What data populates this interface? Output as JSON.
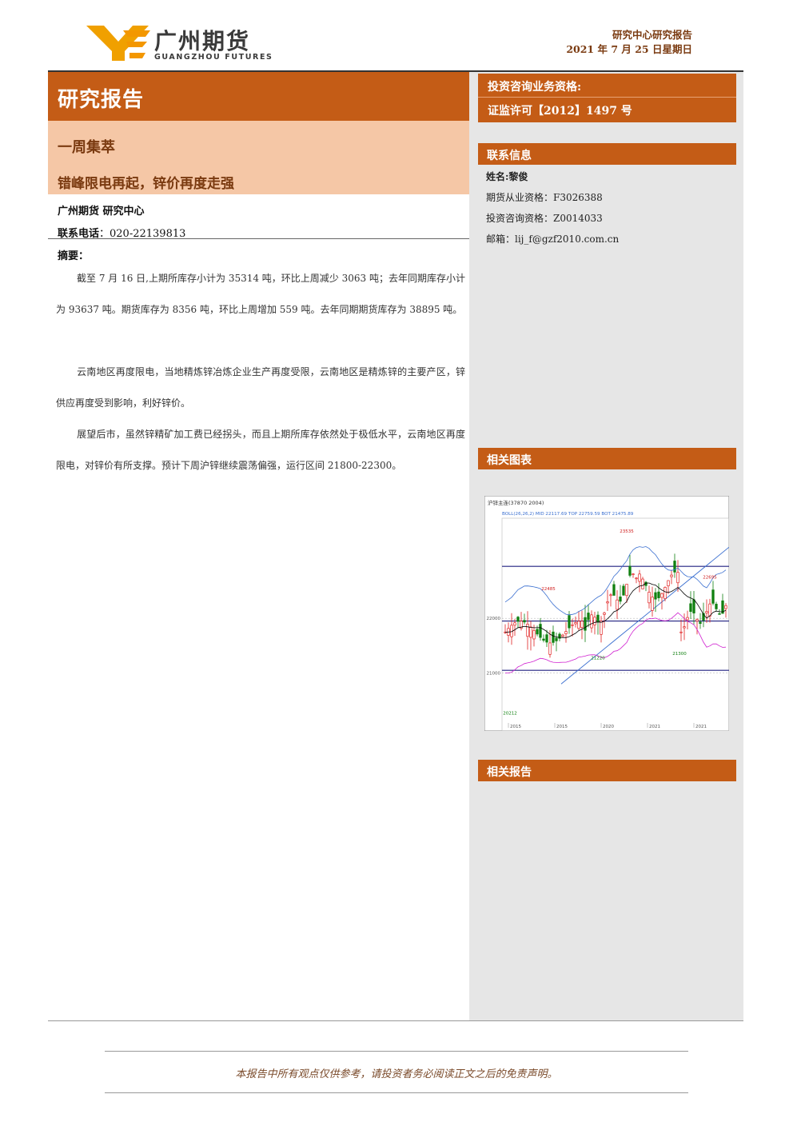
{
  "header": {
    "logo_cn": "广州期货",
    "logo_en": "GUANGZHOU FUTURES",
    "report_type": "研究中心研究报告",
    "date": "2021 年 7 月 25 日星期日",
    "brand_color": "#f0a000"
  },
  "left": {
    "title": "研究报告",
    "category": "一周集萃",
    "headline": "错峰限电再起，锌价再度走强",
    "org": "广州期货 研究中心",
    "phone_label": "联系电话",
    "phone_value": "：020-22139813",
    "summary_label": "摘要：",
    "paragraphs": [
      "截至 7 月 16 日,上期所库存小计为 35314 吨，环比上周减少 3063 吨；去年同期库存小计为 93637 吨。期货库存为 8356 吨，环比上周增加 559 吨。去年同期期货库存为 38895 吨。",
      "云南地区再度限电，当地精炼锌冶炼企业生产再度受限，云南地区是精炼锌的主要产区，锌供应再度受到影响，利好锌价。",
      "展望后市，虽然锌精矿加工费已经拐头，而且上期所库存依然处于极低水平，云南地区再度限电，对锌价有所支撑。预计下周沪锌继续震荡偏强，运行区间 21800-22300。"
    ]
  },
  "right": {
    "qualification_label": "投资咨询业务资格:",
    "qualification_value": "证监许可【2012】1497 号",
    "contact_header": "联系信息",
    "contact": {
      "name": "姓名:黎俊",
      "futures_cert": "期货从业资格：F3026388",
      "advisory_cert": "投资咨询资格：Z0014033",
      "email": "邮箱：lij_f@gzf2010.com.cn"
    },
    "chart_header": "相关图表",
    "reports_header": "相关报告"
  },
  "chart_data": {
    "type": "candlestick",
    "title": "沪锌主连(37870 2004)",
    "indicator": "BOLL(26,26,2)",
    "indicator_values": "MID 22117.69  TOP 22759.59  BOT 21475.89",
    "y_ticks": [
      21000,
      22000
    ],
    "annotations": [
      "23535",
      "22485",
      "22695",
      "21220",
      "21300",
      "20212"
    ],
    "x_ticks": [
      "2015",
      "2015",
      "2020",
      "2021",
      "2021"
    ],
    "colors": {
      "up": "#e02020",
      "down": "#108010",
      "mid": "#000000",
      "top": "#3a6fd0",
      "bot": "#d020d0",
      "hline": "#202080"
    }
  },
  "footer": {
    "disclaimer": "本报告中所有观点仅供参考，请投资者务必阅读正文之后的免责声明。"
  }
}
